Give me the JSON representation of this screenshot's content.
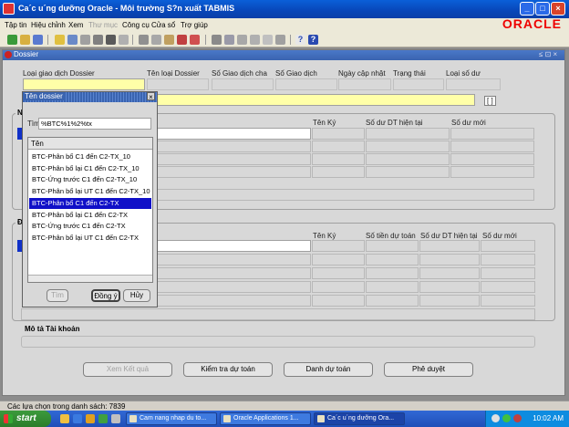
{
  "window": {
    "title": "Ca´c u´ng dưỡng Oracle - Môi trường S?n xuất TABMIS",
    "logo": "ORACLE",
    "controls": {
      "minimize": "_",
      "maximize": "□",
      "close": "×"
    }
  },
  "menu": [
    "Tập tin",
    "Hiệu chỉnh",
    "Xem",
    "Thư mục",
    "Công cụ",
    "Cửa sổ",
    "Trợ giúp"
  ],
  "dossier": {
    "title": "Dossier",
    "controls": "≤ ⊡ ×",
    "header_labels": [
      "Loại giao dịch Dossier",
      "Tên loại Dossier",
      "Số Giao dịch cha",
      "Số Giao dịch",
      "Ngày cập nhật",
      "Trạng thái",
      "Loại số dư"
    ],
    "bracket_field": "[ ]",
    "section1": {
      "title": "N",
      "columns": [
        "Tên Ký",
        "Số dư DT hiện tại",
        "Số dư mới"
      ]
    },
    "section2": {
      "title": "Đ",
      "columns": [
        "Tên Ký",
        "Số tiền dự toán",
        "Số dư DT hiện tại",
        "Số dư mới"
      ]
    },
    "account_desc_label": "Mô tả Tài khoản",
    "buttons": {
      "view_results": "Xem Kết quả",
      "check_budget": "Kiểm tra dự toán",
      "budget_list": "Danh dự toán",
      "approve": "Phê duyệt"
    }
  },
  "modal": {
    "title": "Tên dossier",
    "close": "×",
    "search_label": "Tìm",
    "search_value": "%BTC%1%2%tx",
    "list_header": "Tên",
    "items": [
      "BTC-Phân bổ C1 đến C2-TX_10",
      "BTC-Phân bổ lại C1 đến C2-TX_10",
      "BTC-Ứng trước C1 đến C2-TX_10",
      "BTC-Phân bổ lại UT C1 đến C2-TX_10",
      "BTC-Phân bổ C1 đến C2-TX",
      "BTC-Phân bổ lại C1 đến C2-TX",
      "BTC-Ứng trước C1 đến C2-TX",
      "BTC-Phân bổ lại UT C1 đến C2-TX"
    ],
    "selected_index": 4,
    "buttons": {
      "find": "Tìm",
      "ok": "Đồng ý",
      "cancel": "Hủy"
    }
  },
  "status": "Các lựa chọn trong danh sách: 7839",
  "taskbar": {
    "start": "start",
    "tasks": [
      "Cam nang nhap du to...",
      "Oracle Applications 1...",
      "Ca´c u´ng dưỡng Ora..."
    ],
    "clock": "10:02 AM"
  }
}
